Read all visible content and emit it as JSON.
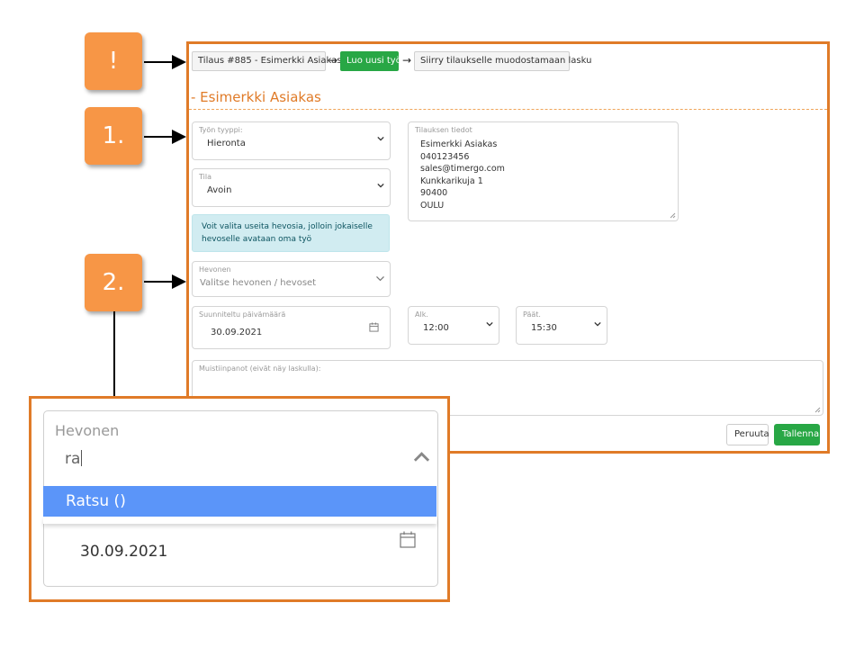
{
  "callouts": [
    "!",
    "1.",
    "2."
  ],
  "header": {
    "breadcrumb_order": "Tilaus #885 - Esimerkki Asiakas",
    "arrow": "→",
    "new_job_button": "Luo uusi työ",
    "invoice_button": "Siirry tilaukselle muodostamaan lasku"
  },
  "page": {
    "title": "- Esimerkki Asiakas"
  },
  "form": {
    "job_type": {
      "label": "Työn tyyppi:",
      "value": "Hieronta"
    },
    "status": {
      "label": "Tila",
      "value": "Avoin"
    },
    "order_info": {
      "label": "Tilauksen tiedot",
      "value": "Esimerkki Asiakas\n040123456\nsales@timergo.com\nKunkkarikuja 1\n90400\nOULU"
    },
    "info_text": "Voit valita useita hevosia, jolloin jokaiselle hevoselle avataan oma työ",
    "horses": {
      "label": "Hevonen",
      "placeholder": "Valitse hevonen / hevoset"
    },
    "planned_date": {
      "label": "Suunniteltu päivämäärä",
      "value": "30.09.2021"
    },
    "start": {
      "label": "Alk.",
      "value": "12:00"
    },
    "end": {
      "label": "Päät.",
      "value": "15:30"
    },
    "notes": {
      "label": "Muistiinpanot (eivät näy laskulla):"
    },
    "cancel_button": "Peruuta",
    "save_button": "Tallenna"
  },
  "zoom": {
    "label": "Hevonen",
    "typed": "ra",
    "option": "Ratsu ()",
    "date": "30.09.2021"
  },
  "colors": {
    "accent": "#e07b28",
    "callout": "#f79646",
    "green": "#28a745",
    "option": "#5b95f9"
  },
  "icons": [
    "chevron-down-icon",
    "chevron-up-icon",
    "calendar-icon",
    "arrow-right-icon"
  ]
}
